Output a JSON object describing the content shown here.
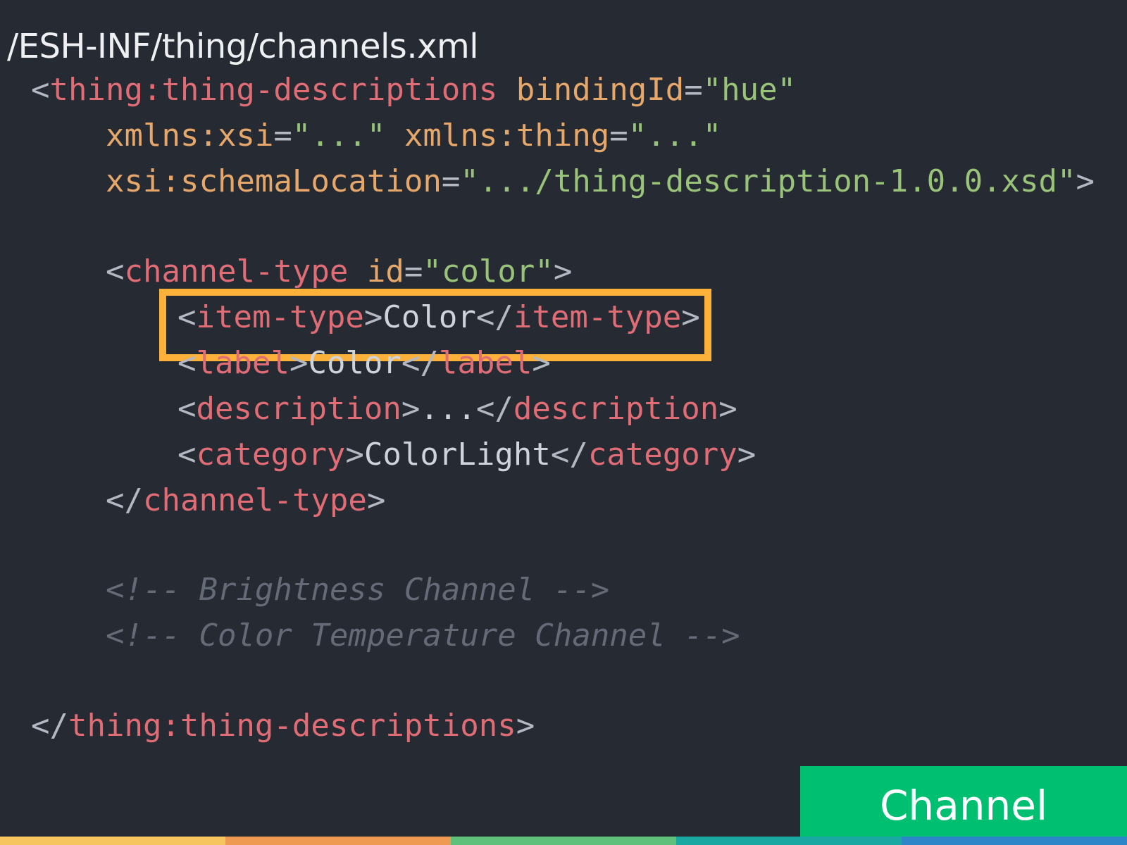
{
  "file_path": "/ESH-INF/thing/channels.xml",
  "code_lines": [
    {
      "tokens": [
        {
          "k": "p",
          "t": "<"
        },
        {
          "k": "t",
          "t": "thing:thing-descriptions"
        },
        {
          "k": "p",
          "t": " "
        },
        {
          "k": "a",
          "t": "bindingId"
        },
        {
          "k": "p",
          "t": "="
        },
        {
          "k": "s",
          "t": "\"hue\""
        }
      ]
    },
    {
      "tokens": [
        {
          "k": "a",
          "t": "xmlns:xsi"
        },
        {
          "k": "p",
          "t": "="
        },
        {
          "k": "s",
          "t": "\"...\""
        },
        {
          "k": "p",
          "t": " "
        },
        {
          "k": "a",
          "t": "xmlns:thing"
        },
        {
          "k": "p",
          "t": "="
        },
        {
          "k": "s",
          "t": "\"...\""
        }
      ]
    },
    {
      "tokens": [
        {
          "k": "a",
          "t": "xsi:schemaLocation"
        },
        {
          "k": "p",
          "t": "="
        },
        {
          "k": "s",
          "t": "\".../thing-description-1.0.0.xsd\""
        },
        {
          "k": "p",
          "t": ">"
        }
      ]
    },
    {
      "tokens": [
        {
          "k": "p",
          "t": "<"
        },
        {
          "k": "t",
          "t": "channel-type"
        },
        {
          "k": "p",
          "t": " "
        },
        {
          "k": "a",
          "t": "id"
        },
        {
          "k": "p",
          "t": "="
        },
        {
          "k": "s",
          "t": "\"color\""
        },
        {
          "k": "p",
          "t": ">"
        }
      ]
    },
    {
      "tokens": [
        {
          "k": "p",
          "t": "<"
        },
        {
          "k": "t",
          "t": "item-type"
        },
        {
          "k": "p",
          "t": ">"
        },
        {
          "k": "x",
          "t": "Color"
        },
        {
          "k": "p",
          "t": "</"
        },
        {
          "k": "t",
          "t": "item-type"
        },
        {
          "k": "p",
          "t": ">"
        }
      ]
    },
    {
      "tokens": [
        {
          "k": "p",
          "t": "<"
        },
        {
          "k": "t",
          "t": "label"
        },
        {
          "k": "p",
          "t": ">"
        },
        {
          "k": "x",
          "t": "Color"
        },
        {
          "k": "p",
          "t": "</"
        },
        {
          "k": "t",
          "t": "label"
        },
        {
          "k": "p",
          "t": ">"
        }
      ]
    },
    {
      "tokens": [
        {
          "k": "p",
          "t": "<"
        },
        {
          "k": "t",
          "t": "description"
        },
        {
          "k": "p",
          "t": ">"
        },
        {
          "k": "x",
          "t": "..."
        },
        {
          "k": "p",
          "t": "</"
        },
        {
          "k": "t",
          "t": "description"
        },
        {
          "k": "p",
          "t": ">"
        }
      ]
    },
    {
      "tokens": [
        {
          "k": "p",
          "t": "<"
        },
        {
          "k": "t",
          "t": "category"
        },
        {
          "k": "p",
          "t": ">"
        },
        {
          "k": "x",
          "t": "ColorLight"
        },
        {
          "k": "p",
          "t": "</"
        },
        {
          "k": "t",
          "t": "category"
        },
        {
          "k": "p",
          "t": ">"
        }
      ]
    },
    {
      "tokens": [
        {
          "k": "p",
          "t": "</"
        },
        {
          "k": "t",
          "t": "channel-type"
        },
        {
          "k": "p",
          "t": ">"
        }
      ]
    },
    {
      "tokens": [
        {
          "k": "c",
          "t": "<!-- Brightness Channel -->"
        }
      ]
    },
    {
      "tokens": [
        {
          "k": "c",
          "t": "<!-- Color Temperature Channel -->"
        }
      ]
    },
    {
      "tokens": [
        {
          "k": "p",
          "t": "</"
        },
        {
          "k": "t",
          "t": "thing:thing-descriptions"
        },
        {
          "k": "p",
          "t": ">"
        }
      ]
    }
  ],
  "badge_label": "Channel",
  "colors": {
    "background": "#262a33",
    "highlight_border": "#fcb13a",
    "badge": "#00bf71",
    "tag": "#e06c75",
    "attribute": "#e5a76a",
    "string": "#98c379",
    "comment": "#646a76",
    "stripe": [
      "#f6c560",
      "#ef9a52",
      "#5fc07c",
      "#1aa8a2",
      "#2c86c8"
    ]
  }
}
